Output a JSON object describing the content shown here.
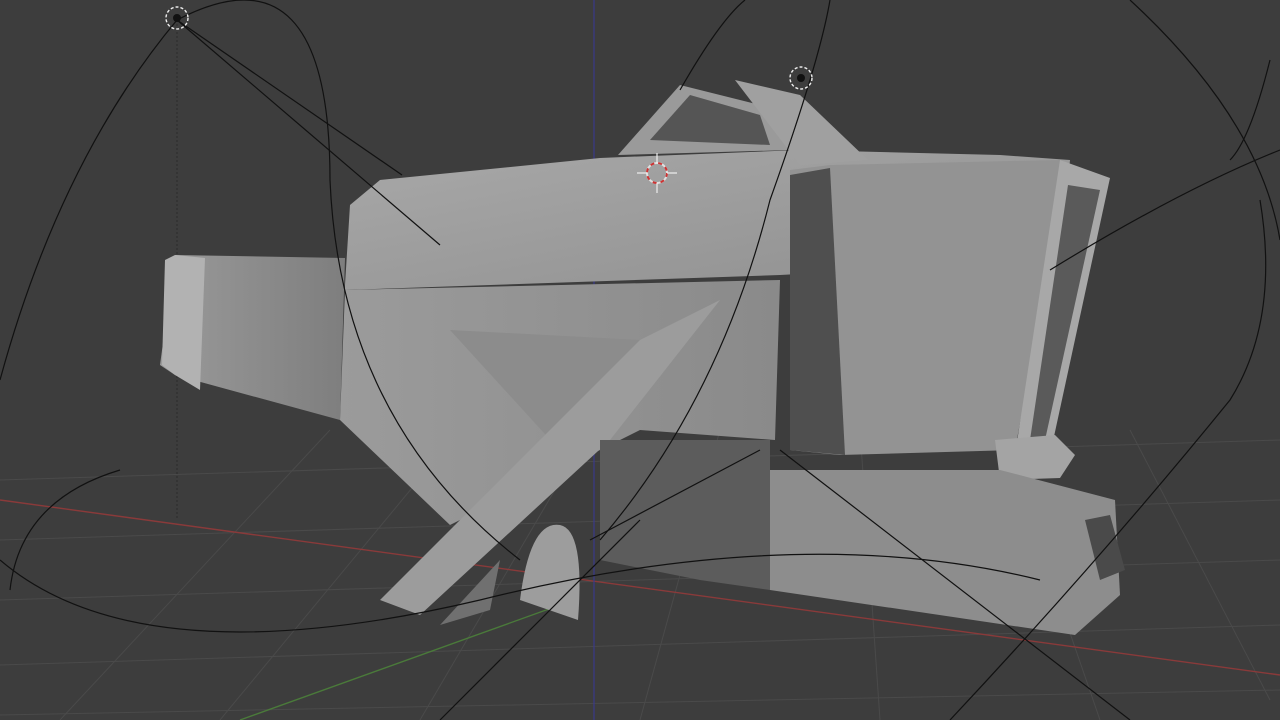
{
  "viewport": {
    "background_color": "#3d3d3d",
    "grid_color": "#4a4a4a",
    "x_axis_color": "#8a3a3a",
    "y_axis_color": "#4a7a3a",
    "z_axis_color": "#3a3a8a",
    "wire_color": "#111111",
    "mesh_shade_light": "#a3a3a3",
    "mesh_shade_mid": "#8e8e8e",
    "mesh_shade_dark": "#5f5f5f"
  },
  "gizmos": {
    "light_icon": "light-icon",
    "cursor_icon": "3d-cursor-icon"
  }
}
